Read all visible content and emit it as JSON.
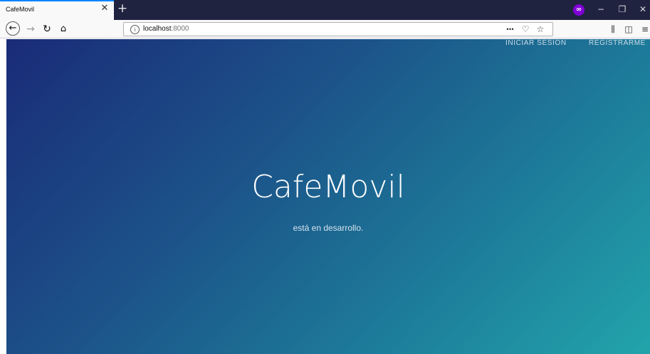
{
  "browser": {
    "tab": {
      "title": "CafeMovil",
      "close_glyph": "✕"
    },
    "new_tab_glyph": "+",
    "private_badge": "∞",
    "window_controls": [
      "−",
      "❐",
      "✕"
    ],
    "url": {
      "host": "localhost",
      "port": ":8000"
    },
    "nav_glyphs": {
      "back": "←",
      "forward": "→",
      "reload": "↻",
      "home": "⌂"
    },
    "url_icons": {
      "info": "i",
      "page_actions": "···",
      "pocket": "♡",
      "bookmark": "☆"
    },
    "toolbar_icons": {
      "library": "⫼",
      "sidebar": "◫",
      "menu": "≡"
    }
  },
  "page": {
    "nav": {
      "login": "INICIAR SESIÓN",
      "register": "REGISTRARME"
    },
    "hero": {
      "title": "CafeMovil",
      "subtitle": "está en desarrollo."
    }
  },
  "colors": {
    "gradient_start": "#1a2b78",
    "gradient_end": "#22a4ab",
    "tabbar": "#202340",
    "private": "#8000d7"
  }
}
